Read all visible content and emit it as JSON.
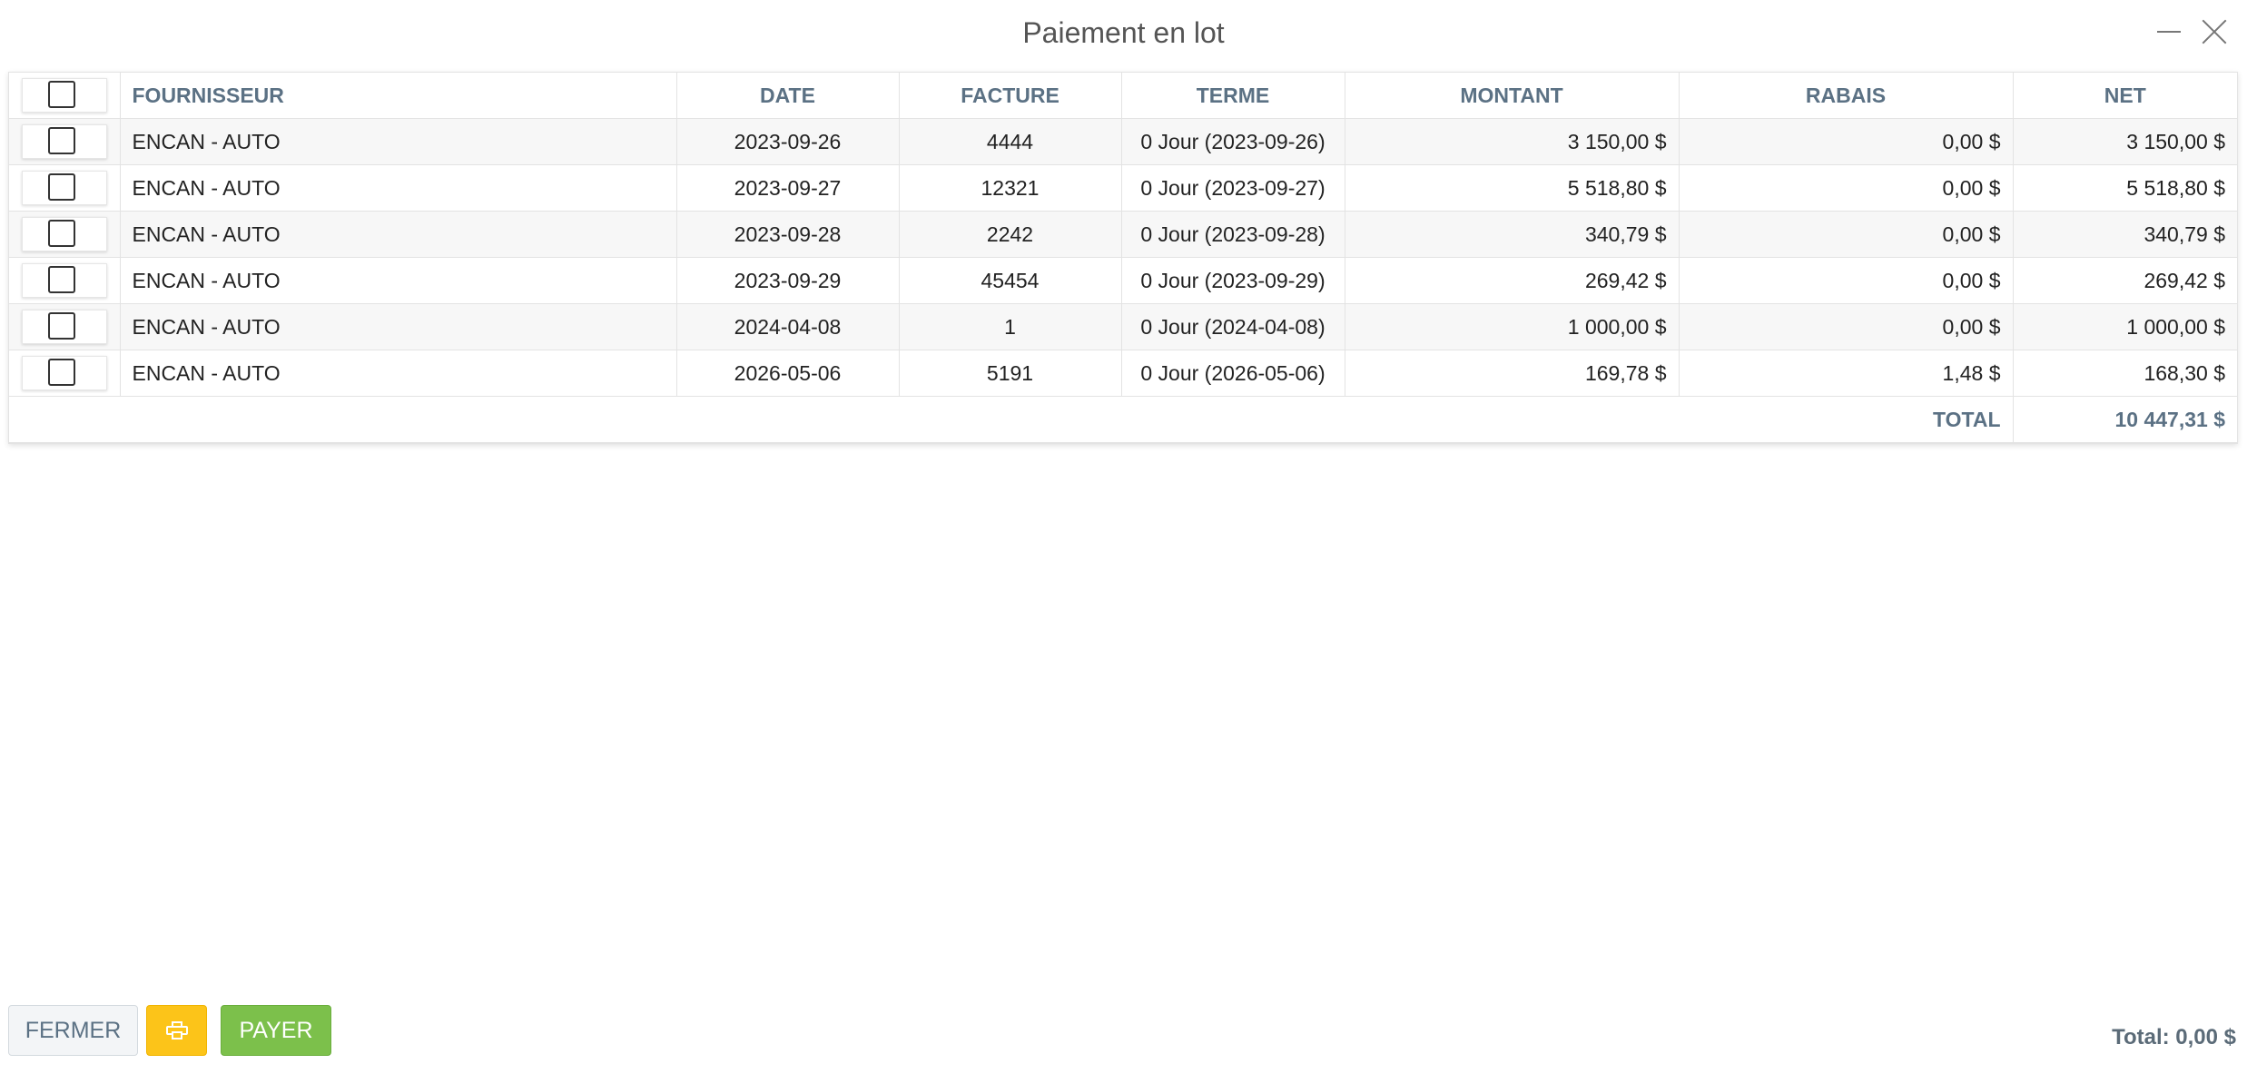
{
  "window": {
    "title": "Paiement en lot"
  },
  "table": {
    "columns": [
      "FOURNISSEUR",
      "DATE",
      "FACTURE",
      "TERME",
      "MONTANT",
      "RABAIS",
      "NET"
    ],
    "rows": [
      {
        "checked": false,
        "supplier": "ENCAN - AUTO",
        "date": "2023-09-26",
        "invoice": "4444",
        "term": "0 Jour (2023-09-26)",
        "amount": "3 150,00 $",
        "discount": "0,00 $",
        "net": "3 150,00 $"
      },
      {
        "checked": false,
        "supplier": "ENCAN - AUTO",
        "date": "2023-09-27",
        "invoice": "12321",
        "term": "0 Jour (2023-09-27)",
        "amount": "5 518,80 $",
        "discount": "0,00 $",
        "net": "5 518,80 $"
      },
      {
        "checked": false,
        "supplier": "ENCAN - AUTO",
        "date": "2023-09-28",
        "invoice": "2242",
        "term": "0 Jour (2023-09-28)",
        "amount": "340,79 $",
        "discount": "0,00 $",
        "net": "340,79 $"
      },
      {
        "checked": false,
        "supplier": "ENCAN - AUTO",
        "date": "2023-09-29",
        "invoice": "45454",
        "term": "0 Jour (2023-09-29)",
        "amount": "269,42 $",
        "discount": "0,00 $",
        "net": "269,42 $"
      },
      {
        "checked": false,
        "supplier": "ENCAN - AUTO",
        "date": "2024-04-08",
        "invoice": "1",
        "term": "0 Jour (2024-04-08)",
        "amount": "1 000,00 $",
        "discount": "0,00 $",
        "net": "1 000,00 $"
      },
      {
        "checked": false,
        "supplier": "ENCAN - AUTO",
        "date": "2026-05-06",
        "invoice": "5191",
        "term": "0 Jour (2026-05-06)",
        "amount": "169,78 $",
        "discount": "1,48 $",
        "net": "168,30 $"
      }
    ],
    "total_label": "TOTAL",
    "total_value": "10 447,31 $"
  },
  "footer": {
    "close_label": "FERMER",
    "print_icon": "printer-icon",
    "pay_label": "PAYER",
    "grand_total": "Total: 0,00 $"
  },
  "colors": {
    "header_text": "#5b7184",
    "print_button": "#fcc419",
    "pay_button": "#7cc04b"
  }
}
